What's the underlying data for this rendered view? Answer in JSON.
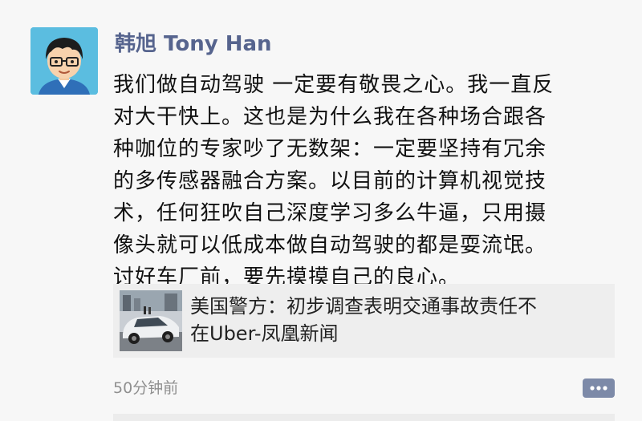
{
  "post": {
    "author": "韩旭 Tony Han",
    "text_lines": [
      "我们做自动驾驶 一定要有敬畏之心。我一直反",
      "对大干快上。这也是为什么我在各种场合跟各",
      "种咖位的专家吵了无数架：一定要坚持有冗余",
      "的多传感器融合方案。以目前的计算机视觉技",
      "术，任何狂吹自己深度学习多么牛逼，只用摄",
      "像头就可以低成本做自动驾驶的都是耍流氓。",
      "讨好车厂前，要先摸摸自己的良心。"
    ],
    "link": {
      "title_lines": [
        "美国警方：初步调查表明交通事故责任不",
        "在Uber-凤凰新闻"
      ],
      "thumbnail_icon": "news-photo-car-thumbnail"
    },
    "timestamp": "50分钟前",
    "comment_icon": "comment-icon"
  },
  "colors": {
    "background": "#f7f7f7",
    "author_name": "#56648e",
    "link_card_bg": "#eeeeee",
    "timestamp": "#8f8f8f",
    "comment_button": "#7d8aa8"
  }
}
